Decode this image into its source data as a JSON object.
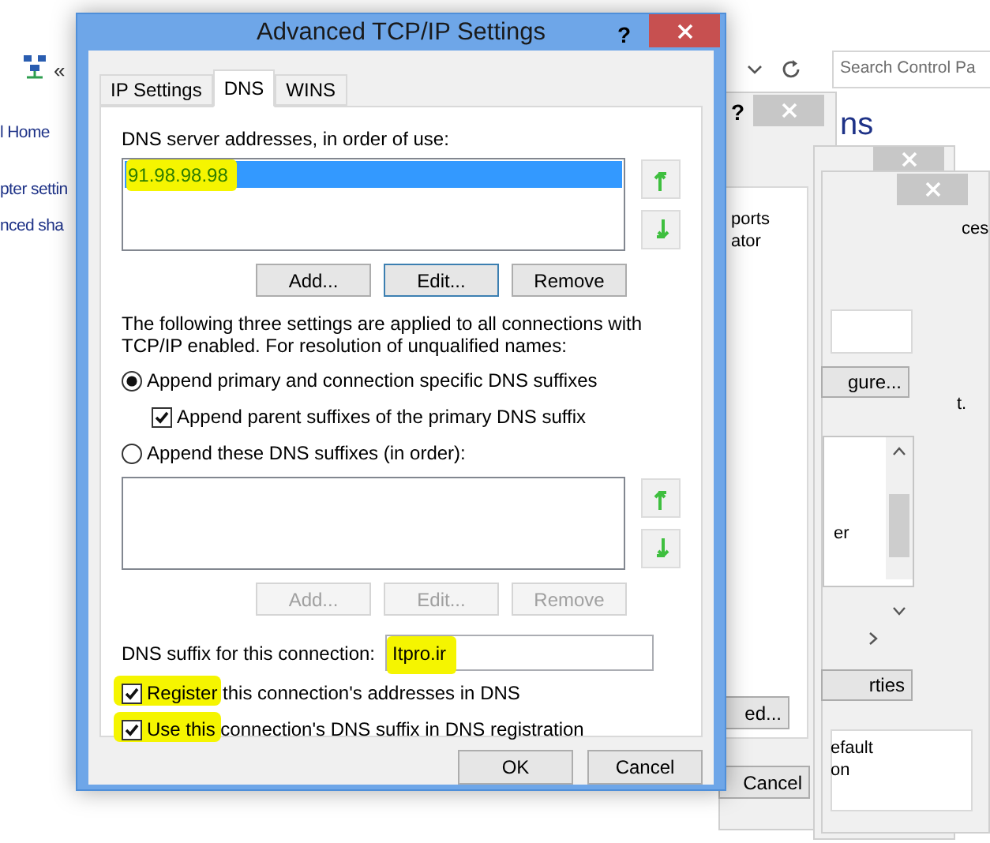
{
  "explorer": {
    "nav_chevron": "«",
    "search": {
      "placeholder": "Search Control Pa"
    },
    "left_links": [
      "l Home",
      "pter settin",
      "nced sha"
    ],
    "heading": "ns"
  },
  "behind_windows": [
    {
      "kind": "help",
      "text": "?"
    },
    {
      "kind": "text",
      "text": "ports"
    },
    {
      "kind": "text",
      "text": "ator"
    },
    {
      "kind": "text",
      "text": "ces"
    },
    {
      "kind": "button",
      "text": "gure..."
    },
    {
      "kind": "text",
      "text": "t."
    },
    {
      "kind": "text",
      "text": "er"
    },
    {
      "kind": "button",
      "text": "rties"
    },
    {
      "kind": "button",
      "text": "ed..."
    },
    {
      "kind": "text",
      "text": "efault"
    },
    {
      "kind": "text",
      "text": "on"
    },
    {
      "kind": "button",
      "text": "Cancel"
    }
  ],
  "dialog": {
    "title": "Advanced TCP/IP Settings",
    "help": "?",
    "tabs": [
      {
        "label": "IP Settings",
        "selected": false
      },
      {
        "label": "DNS",
        "selected": true
      },
      {
        "label": "WINS",
        "selected": false
      }
    ],
    "dns_servers": {
      "label": "DNS server addresses, in order of use:",
      "items": [
        {
          "text": "91.98.98.98",
          "selected": true,
          "highlighted": true
        }
      ],
      "buttons": [
        {
          "label": "Add...",
          "disabled": false,
          "focused": false
        },
        {
          "label": "Edit...",
          "disabled": false,
          "focused": true
        },
        {
          "label": "Remove",
          "disabled": false,
          "focused": false
        }
      ]
    },
    "info": "The following three settings are applied to all connections with TCP/IP enabled. For resolution of unqualified names:",
    "options": [
      {
        "kind": "radio",
        "label": "Append primary and connection specific DNS suffixes",
        "checked": true
      },
      {
        "kind": "checkbox",
        "label": "Append parent suffixes of the primary DNS suffix",
        "checked": true
      },
      {
        "kind": "radio",
        "label": "Append these DNS suffixes (in order):",
        "checked": false
      }
    ],
    "suffixes": {
      "buttons": [
        {
          "label": "Add...",
          "disabled": true
        },
        {
          "label": "Edit...",
          "disabled": true
        },
        {
          "label": "Remove",
          "disabled": true
        }
      ]
    },
    "suffix_field": {
      "label": "DNS suffix for this connection:",
      "value": "Itpro.ir",
      "highlighted": true
    },
    "registration": [
      {
        "label": "Register this connection's addresses in DNS",
        "checked": true,
        "highlighted": true
      },
      {
        "label": "Use this connection's DNS suffix in DNS registration",
        "checked": true,
        "highlighted": true
      }
    ],
    "footer": [
      "OK",
      "Cancel"
    ]
  }
}
